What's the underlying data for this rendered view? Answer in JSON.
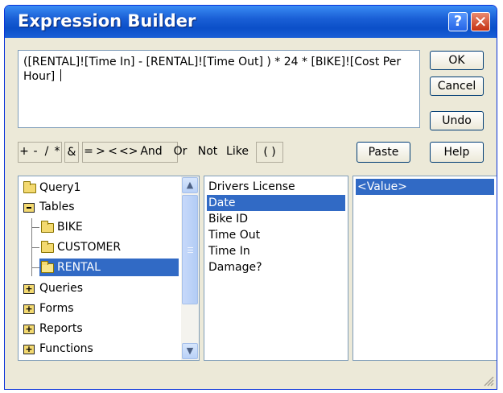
{
  "window": {
    "title": "Expression Builder",
    "help_glyph": "?",
    "close_glyph": "✕"
  },
  "expression": {
    "text": "([RENTAL]![Time In] - [RENTAL]![Time Out] ) * 24 * [BIKE]![Cost Per Hour] "
  },
  "buttons": {
    "ok": "OK",
    "cancel": "Cancel",
    "undo": "Undo",
    "paste": "Paste",
    "help": "Help"
  },
  "operators": [
    "+",
    "-",
    "/",
    "*",
    "&",
    "=",
    ">",
    "<",
    "<>",
    "And",
    "Or",
    "Not",
    "Like",
    "( )"
  ],
  "tree": {
    "items": [
      {
        "label": "Query1",
        "icon": "folder-icon"
      },
      {
        "label": "Tables",
        "icon": "minus-folder-icon"
      },
      {
        "label": "BIKE",
        "icon": "folder-icon"
      },
      {
        "label": "CUSTOMER",
        "icon": "folder-icon"
      },
      {
        "label": "RENTAL",
        "icon": "open-folder-icon"
      },
      {
        "label": "Queries",
        "icon": "plus-folder-icon"
      },
      {
        "label": "Forms",
        "icon": "plus-folder-icon"
      },
      {
        "label": "Reports",
        "icon": "plus-folder-icon"
      },
      {
        "label": "Functions",
        "icon": "plus-folder-icon"
      }
    ]
  },
  "fields": {
    "items": [
      "Drivers License",
      "Date",
      "Bike ID",
      "Time Out",
      "Time In",
      "Damage?"
    ],
    "selected": "Date"
  },
  "values": {
    "items": [
      "<Value>"
    ],
    "selected": "<Value>"
  },
  "colors": {
    "title_bar": "#1a5fd6",
    "selection": "#316ac5",
    "dialog_bg": "#ece9d8"
  }
}
